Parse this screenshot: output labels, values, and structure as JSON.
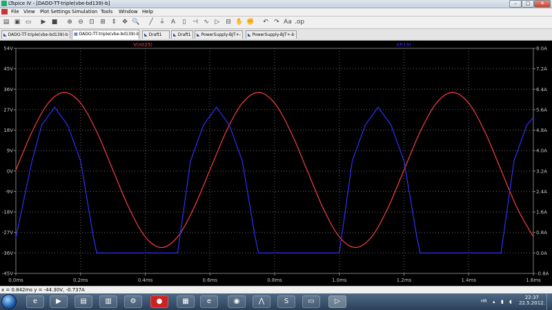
{
  "window": {
    "title": "LTspice IV - [DADO-TT-triple(vbe-bd139)-b]",
    "min_label": "–",
    "max_label": "□",
    "close_label": "✕"
  },
  "menu": [
    "File",
    "View",
    "Plot Settings",
    "Simulation",
    "Tools",
    "Window",
    "Help"
  ],
  "toolbar_icons": [
    "open-icon",
    "save-icon",
    "print-icon",
    "run-icon",
    "halt-icon",
    "zoom-in-icon",
    "zoom-out-icon",
    "zoom-fit-icon",
    "zoom-area-icon",
    "autorange-icon",
    "pan-icon",
    "find-icon",
    "wire-icon",
    "ground-icon",
    "label-icon",
    "resistor-icon",
    "capacitor-icon",
    "inductor-icon",
    "diode-icon",
    "component-icon",
    "move-icon",
    "drag-icon",
    "undo-icon",
    "redo-icon",
    "text-icon",
    "spice-directive-icon"
  ],
  "tabs": [
    {
      "label": "DADO-TT-triple(vbe-bd139)-b",
      "active": false
    },
    {
      "label": "DADO-TT-triple(vbe-bd139)-b",
      "active": true
    },
    {
      "label": "Draft1",
      "active": false
    },
    {
      "label": "Draft1",
      "active": false
    },
    {
      "label": "PowerSupply-BJT+-",
      "active": false
    },
    {
      "label": "PowerSupply-BJT+-b",
      "active": false
    }
  ],
  "statusbar": {
    "cursor_text": "x = 0.842ms   y = -44.30V, -0.737A"
  },
  "taskbar": {
    "language": "HR",
    "time": "22:37",
    "date": "22.5.2012."
  },
  "chart_data": {
    "type": "line",
    "series": [
      {
        "name": "V(n025)",
        "color": "#ff4040",
        "axis": "left",
        "x": [
          0.0,
          0.05,
          0.1,
          0.15,
          0.2,
          0.25,
          0.3,
          0.35,
          0.4,
          0.45,
          0.5,
          0.55,
          0.6,
          0.65,
          0.7,
          0.75,
          0.8,
          0.85,
          0.9,
          0.95,
          1.0,
          1.05,
          1.1,
          1.15,
          1.2,
          1.25,
          1.3,
          1.35,
          1.4,
          1.45,
          1.5,
          1.55,
          1.6
        ],
        "y": [
          0.5,
          17.3,
          29.9,
          34.6,
          29.9,
          17.3,
          0.5,
          -16.3,
          -28.9,
          -33.6,
          -28.9,
          -16.3,
          0.5,
          17.3,
          29.9,
          34.6,
          29.9,
          17.3,
          0.5,
          -16.3,
          -28.9,
          -33.6,
          -28.9,
          -16.3,
          0.5,
          17.3,
          29.9,
          34.6,
          29.9,
          17.3,
          0.5,
          -16.3,
          -28.9
        ]
      },
      {
        "name": "I(R19)",
        "color": "#3030ff",
        "axis": "right",
        "x": [
          0.0,
          0.05,
          0.08,
          0.12,
          0.16,
          0.2,
          0.24,
          0.25,
          0.5,
          0.54,
          0.58,
          0.62,
          0.66,
          0.7,
          0.74,
          0.75,
          1.0,
          1.04,
          1.08,
          1.12,
          1.16,
          1.2,
          1.24,
          1.25,
          1.5,
          1.54,
          1.58,
          1.6
        ],
        "y": [
          0.6,
          3.6,
          5.0,
          5.7,
          5.0,
          3.6,
          0.6,
          0.0,
          0.0,
          3.6,
          5.0,
          5.7,
          5.0,
          3.6,
          0.6,
          0.0,
          0.0,
          3.6,
          5.0,
          5.7,
          5.0,
          3.6,
          0.6,
          0.0,
          0.0,
          3.6,
          5.0,
          5.3
        ]
      }
    ],
    "xlim": [
      0.0,
      1.6
    ],
    "ylim_left": [
      -45,
      54
    ],
    "ylim_right": [
      -0.8,
      8.0
    ],
    "x_ticks": [
      "0.0ms",
      "0.2ms",
      "0.4ms",
      "0.6ms",
      "0.8ms",
      "1.0ms",
      "1.2ms",
      "1.4ms",
      "1.6ms"
    ],
    "y_ticks_left": [
      "54V",
      "45V",
      "36V",
      "27V",
      "18V",
      "9V",
      "0V",
      "-9V",
      "-18V",
      "-27V",
      "-36V",
      "-45V"
    ],
    "y_ticks_right": [
      "8.0A",
      "7.2A",
      "6.4A",
      "5.6A",
      "4.8A",
      "4.0A",
      "3.2A",
      "2.4A",
      "1.6A",
      "0.8A",
      "0.0A",
      "-0.8A"
    ],
    "grid": true,
    "legend": "top"
  }
}
